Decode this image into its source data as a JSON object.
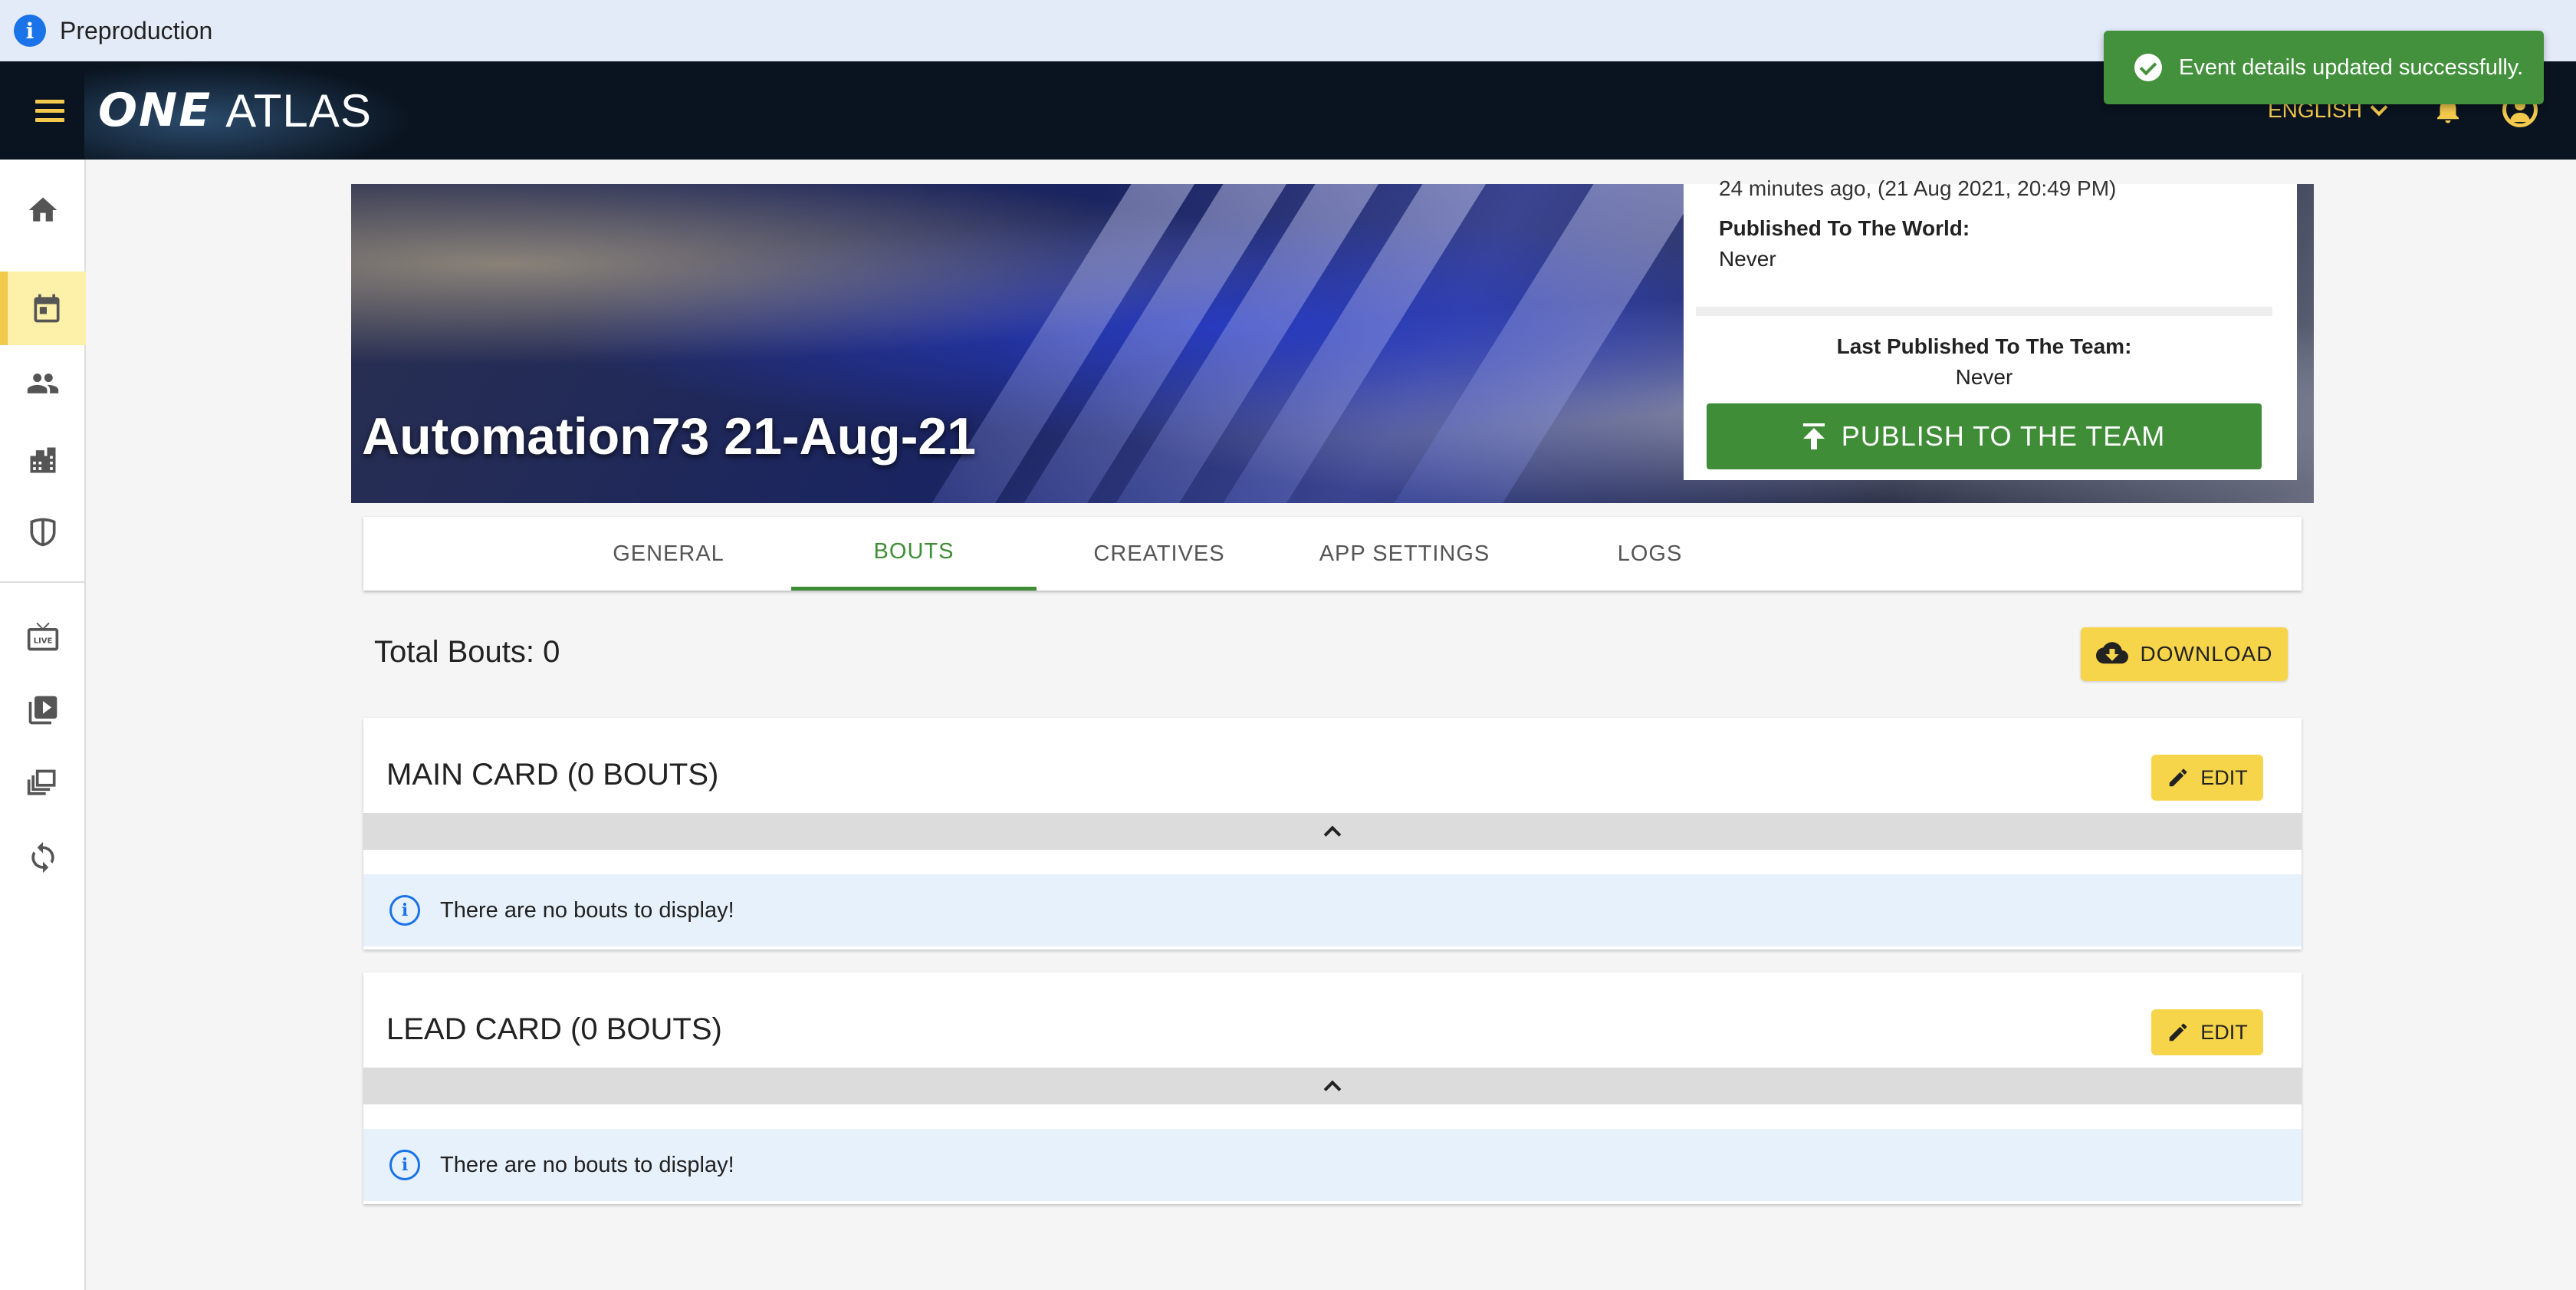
{
  "env": {
    "label": "Preproduction"
  },
  "app": {
    "logo_one": "ONE",
    "logo_atlas": "ATLAS",
    "language": "ENGLISH"
  },
  "snackbar": {
    "message": "Event details updated successfully."
  },
  "sidenav": {
    "items": [
      "home-icon",
      "calendar-icon",
      "people-icon",
      "organization-icon",
      "shield-icon",
      "live-tv-icon",
      "video-library-icon",
      "library-icon",
      "sync-icon"
    ],
    "active": "calendar-icon"
  },
  "event": {
    "title": "Automation73 21-Aug-21",
    "updated_ago": "24 minutes ago, (21 Aug 2021, 20:49 PM)",
    "published_world_label": "Published To The World:",
    "published_world_value": "Never",
    "published_team_label": "Last Published To The Team:",
    "published_team_value": "Never",
    "publish_button": "PUBLISH TO THE TEAM"
  },
  "tabs": [
    "GENERAL",
    "BOUTS",
    "CREATIVES",
    "APP SETTINGS",
    "LOGS"
  ],
  "active_tab": "BOUTS",
  "bouts": {
    "total_label": "Total Bouts: 0",
    "download_label": "DOWNLOAD",
    "cards": [
      {
        "title": "MAIN CARD (0 BOUTS)",
        "edit_label": "EDIT",
        "empty_text": "There are no bouts to display!"
      },
      {
        "title": "LEAD CARD (0 BOUTS)",
        "edit_label": "EDIT",
        "empty_text": "There are no bouts to display!"
      }
    ]
  },
  "colors": {
    "accent_yellow": "#f7d54a",
    "accent_green": "#3f8d36",
    "topbar": "#0a1420",
    "env_banner": "#e4ebf8"
  }
}
